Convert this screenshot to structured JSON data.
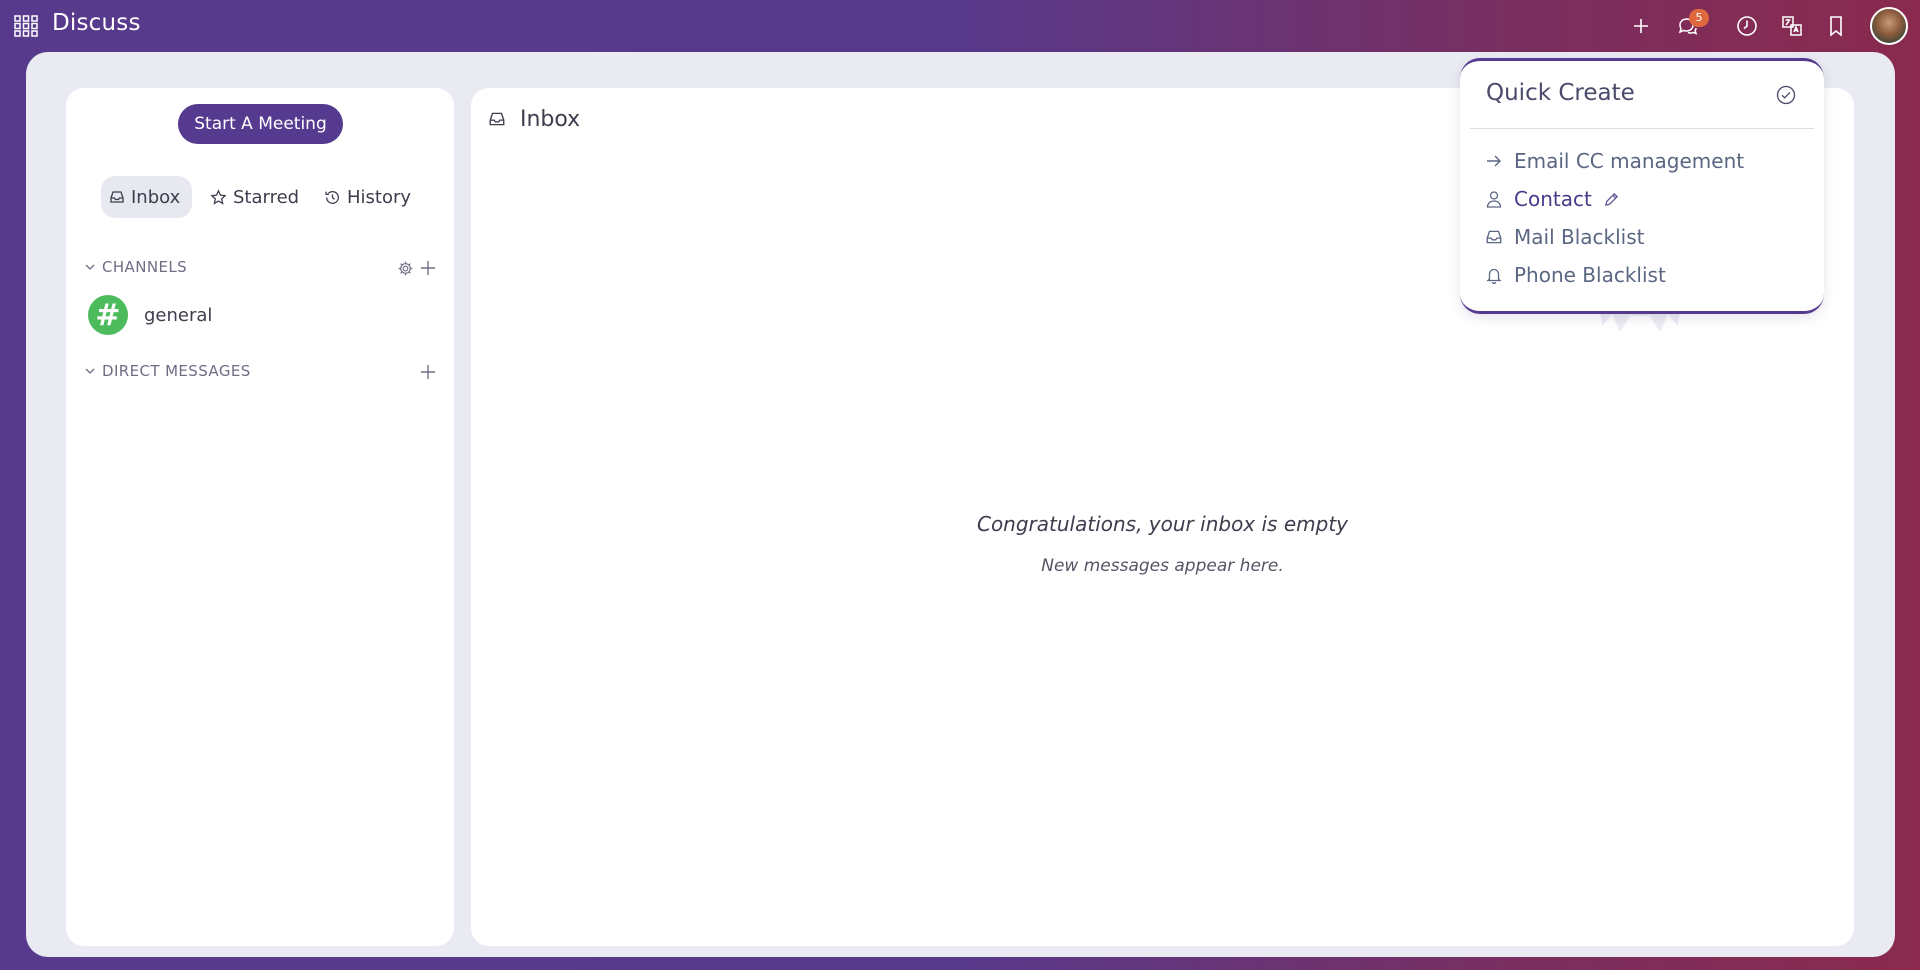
{
  "app": {
    "title": "Discuss"
  },
  "topbar": {
    "icons": [
      "plus-icon",
      "chat-icon",
      "clock-icon",
      "translate-icon",
      "bookmark-icon"
    ],
    "message_badge": "5"
  },
  "sidebar": {
    "meeting_button": "Start A Meeting",
    "tabs": [
      {
        "label": "Inbox",
        "icon": "inbox-icon",
        "active": true
      },
      {
        "label": "Starred",
        "icon": "star-icon",
        "active": false
      },
      {
        "label": "History",
        "icon": "history-icon",
        "active": false
      }
    ],
    "channels_label": "CHANNELS",
    "channels": [
      {
        "name": "general",
        "icon": "#"
      }
    ],
    "dm_label": "DIRECT MESSAGES"
  },
  "main": {
    "title": "Inbox",
    "empty_title": "Congratulations, your inbox is empty",
    "empty_sub": "New messages appear here."
  },
  "quick_create": {
    "title": "Quick Create",
    "items": [
      {
        "label": "Email CC management",
        "icon": "arrow-right-icon"
      },
      {
        "label": "Contact",
        "icon": "person-icon",
        "extra_icon": "pencil-icon"
      },
      {
        "label": "Mail Blacklist",
        "icon": "inbox-tray-icon"
      },
      {
        "label": "Phone Blacklist",
        "icon": "bell-icon"
      }
    ]
  },
  "colors": {
    "brand": "#563a8f",
    "channel_green": "#4cbb5c",
    "badge": "#e0683f"
  }
}
